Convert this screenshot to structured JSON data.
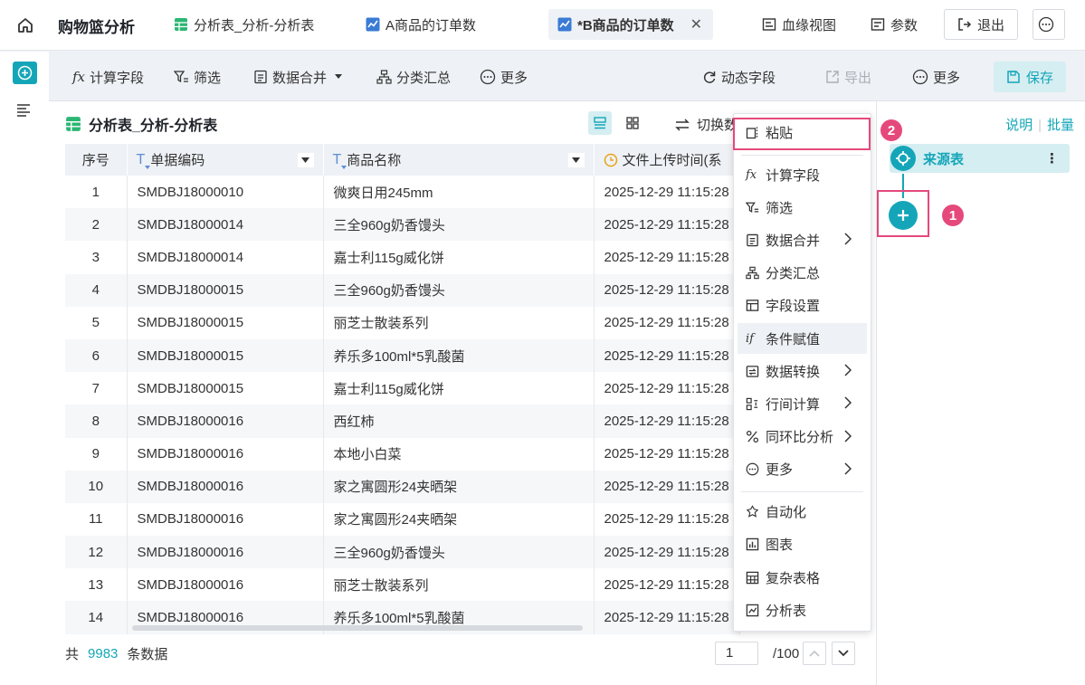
{
  "app_title": "购物篮分析",
  "tabs": [
    {
      "label": "分析表_分析-分析表"
    },
    {
      "label": "A商品的订单数"
    },
    {
      "label": "*B商品的订单数"
    }
  ],
  "header_actions": {
    "lineage": "血缘视图",
    "params": "参数",
    "exit": "退出"
  },
  "toolbar": {
    "calc_field": "计算字段",
    "filter": "筛选",
    "merge": "数据合并",
    "group_sum": "分类汇总",
    "more": "更多",
    "dynamic_field": "动态字段",
    "export": "导出",
    "more_right": "更多",
    "save": "保存"
  },
  "panel": {
    "title": "分析表_分析-分析表",
    "switch_label": "切换数",
    "columns": [
      "序号",
      "单据编码",
      "商品名称",
      "文件上传时间(系"
    ],
    "rows": [
      [
        "1",
        "SMDBJ18000010",
        "微爽日用245mm",
        "2025-12-29 11:15:28"
      ],
      [
        "2",
        "SMDBJ18000014",
        "三全960g奶香馒头",
        "2025-12-29 11:15:28"
      ],
      [
        "3",
        "SMDBJ18000014",
        "嘉士利115g威化饼",
        "2025-12-29 11:15:28"
      ],
      [
        "4",
        "SMDBJ18000015",
        "三全960g奶香馒头",
        "2025-12-29 11:15:28"
      ],
      [
        "5",
        "SMDBJ18000015",
        "丽芝士散装系列",
        "2025-12-29 11:15:28"
      ],
      [
        "6",
        "SMDBJ18000015",
        "养乐多100ml*5乳酸菌",
        "2025-12-29 11:15:28"
      ],
      [
        "7",
        "SMDBJ18000015",
        "嘉士利115g威化饼",
        "2025-12-29 11:15:28"
      ],
      [
        "8",
        "SMDBJ18000016",
        "西红柿",
        "2025-12-29 11:15:28"
      ],
      [
        "9",
        "SMDBJ18000016",
        "本地小白菜",
        "2025-12-29 11:15:28"
      ],
      [
        "10",
        "SMDBJ18000016",
        "家之寓圆形24夹晒架",
        "2025-12-29 11:15:28"
      ],
      [
        "11",
        "SMDBJ18000016",
        "家之寓圆形24夹晒架",
        "2025-12-29 11:15:28"
      ],
      [
        "12",
        "SMDBJ18000016",
        "三全960g奶香馒头",
        "2025-12-29 11:15:28"
      ],
      [
        "13",
        "SMDBJ18000016",
        "丽芝士散装系列",
        "2025-12-29 11:15:28"
      ],
      [
        "14",
        "SMDBJ18000016",
        "养乐多100ml*5乳酸菌",
        "2025-12-29 11:15:28"
      ]
    ],
    "footer_prefix": "共",
    "record_count": "9983",
    "footer_suffix": "条数据",
    "page_current": "1",
    "page_total": "/100"
  },
  "right_panel": {
    "link_explain": "说明",
    "link_batch": "批量",
    "source_node": "来源表",
    "badge_1": "1",
    "badge_2": "2"
  },
  "context_menu": {
    "paste": "粘贴",
    "items": [
      "计算字段",
      "筛选",
      "数据合并",
      "分类汇总",
      "字段设置",
      "条件赋值",
      "数据转换",
      "行间计算",
      "同环比分析",
      "更多"
    ],
    "items2": [
      "自动化",
      "图表",
      "复杂表格",
      "分析表"
    ]
  },
  "colors": {
    "accent": "#14a6b8",
    "highlight": "#e5497b"
  }
}
